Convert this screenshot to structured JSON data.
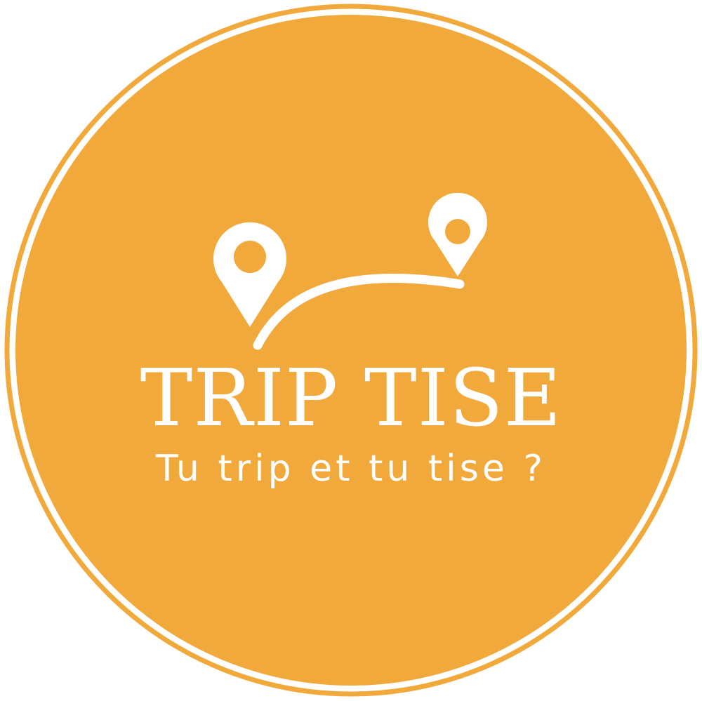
{
  "logo": {
    "brand_name": "TRIP TISE",
    "tagline": "Tu trip et tu tise ?",
    "icons": [
      "map-pin-icon",
      "map-pin-icon",
      "route-arc-icon"
    ]
  },
  "colors": {
    "badge_fill": "#F2A93B",
    "foreground": "#FFFFFF",
    "background": "#FFFFFF"
  }
}
